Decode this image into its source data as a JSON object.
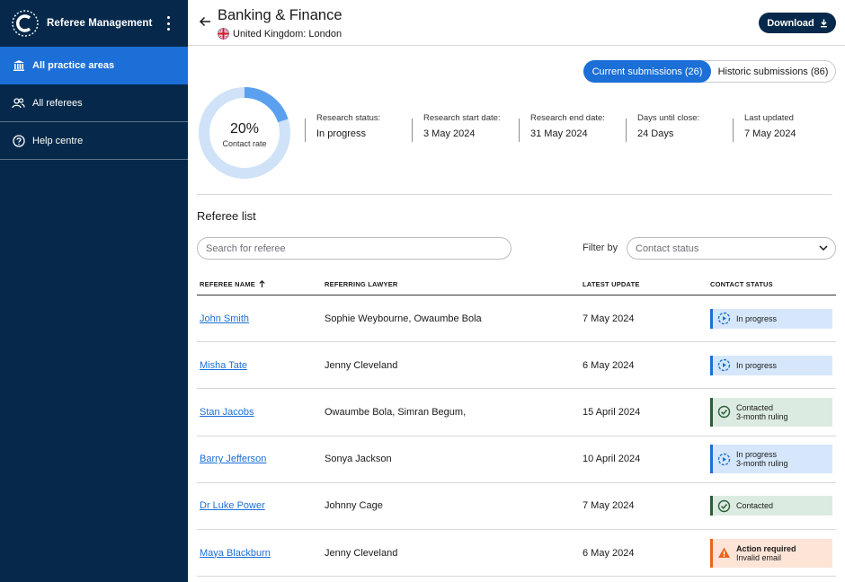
{
  "sidebar": {
    "brand_title": "Referee Management",
    "items": [
      {
        "label": "All practice areas",
        "icon": "bank-icon",
        "active": true
      },
      {
        "label": "All referees",
        "icon": "people-icon",
        "active": false
      },
      {
        "label": "Help centre",
        "icon": "help-icon",
        "active": false
      }
    ]
  },
  "header": {
    "title": "Banking & Finance",
    "location": "United Kingdom: London",
    "download_label": "Download"
  },
  "submissions": {
    "current_label": "Current submissions (26)",
    "historic_label": "Historic submissions (86)"
  },
  "summary": {
    "contact_rate_value": 20,
    "contact_rate_text": "20%",
    "contact_rate_caption": "Contact rate",
    "stats": [
      {
        "label": "Research status:",
        "value": "In progress"
      },
      {
        "label": "Research start date:",
        "value": "3 May 2024"
      },
      {
        "label": "Research end date:",
        "value": "31 May 2024"
      },
      {
        "label": "Days until close:",
        "value": "24 Days"
      },
      {
        "label": "Last updated",
        "value": "7 May 2024"
      }
    ]
  },
  "referee_list": {
    "title": "Referee list",
    "search_placeholder": "Search for referee",
    "filter_label": "Filter by",
    "filter_placeholder": "Contact status",
    "columns": [
      "REFEREE NAME",
      "REFERRING LAWYER",
      "LATEST UPDATE",
      "CONTACT STATUS"
    ],
    "rows": [
      {
        "name": "John Smith",
        "lawyer": "Sophie Weybourne, Owaumbe Bola",
        "update": "7 May 2024",
        "status_line1": "In progress",
        "status_line2": "",
        "status_type": "progress"
      },
      {
        "name": "Misha Tate",
        "lawyer": "Jenny Cleveland",
        "update": "6 May 2024",
        "status_line1": "In progress",
        "status_line2": "",
        "status_type": "progress"
      },
      {
        "name": "Stan Jacobs",
        "lawyer": "Owaumbe Bola, Simran Begum,",
        "update": "15 April 2024",
        "status_line1": "Contacted",
        "status_line2": "3-month ruling",
        "status_type": "contacted"
      },
      {
        "name": "Barry Jefferson",
        "lawyer": "Sonya Jackson",
        "update": "10 April 2024",
        "status_line1": "In progress",
        "status_line2": "3-month ruling",
        "status_type": "progress"
      },
      {
        "name": "Dr Luke Power",
        "lawyer": "Johnny Cage",
        "update": "7 May 2024",
        "status_line1": "Contacted",
        "status_line2": "",
        "status_type": "contacted"
      },
      {
        "name": "Maya Blackburn",
        "lawyer": "Jenny Cleveland",
        "update": "6 May 2024",
        "status_line1": "Action required",
        "status_line2": "Invalid email",
        "status_type": "action"
      }
    ]
  },
  "colors": {
    "sidebar_bg": "#06294b",
    "accent": "#1c6fd7",
    "donut_track": "#cfe2f8",
    "donut_fill": "#5aa0ee"
  }
}
